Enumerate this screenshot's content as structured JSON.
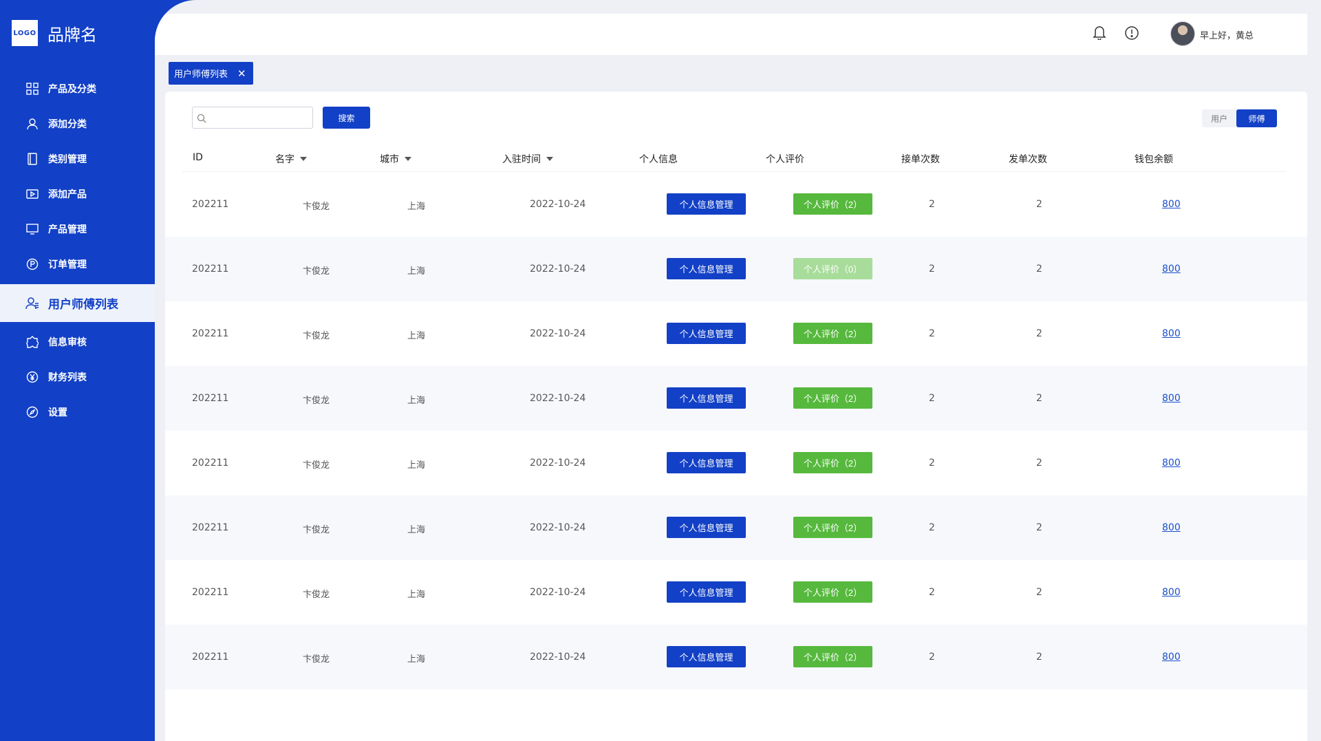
{
  "brand": {
    "logo_text": "LOGO",
    "name": "品牌名"
  },
  "sidebar": {
    "items": [
      {
        "label": "产品及分类",
        "icon": "grid-icon"
      },
      {
        "label": "添加分类",
        "icon": "user-icon"
      },
      {
        "label": "类别管理",
        "icon": "book-icon"
      },
      {
        "label": "添加产品",
        "icon": "video-icon"
      },
      {
        "label": "产品管理",
        "icon": "monitor-icon"
      },
      {
        "label": "订单管理",
        "icon": "order-icon"
      },
      {
        "label": "用户师傅列表",
        "icon": "users-icon",
        "active": true
      },
      {
        "label": "信息审核",
        "icon": "audit-icon"
      },
      {
        "label": "财务列表",
        "icon": "yen-icon"
      },
      {
        "label": "设置",
        "icon": "compass-icon"
      }
    ]
  },
  "header": {
    "greeting": "早上好，黄总"
  },
  "tabs": [
    {
      "label": "用户师傅列表"
    }
  ],
  "toolbar": {
    "search_placeholder": "",
    "search_label": "搜索",
    "toggle": [
      "用户",
      "师傅"
    ],
    "toggle_selected": "师傅"
  },
  "table": {
    "headers": [
      "ID",
      "名字",
      "城市",
      "入驻时间",
      "个人信息",
      "个人评价",
      "接单次数",
      "发单次数",
      "钱包余额"
    ],
    "info_btn_label": "个人信息管理",
    "rows": [
      {
        "id": "202211",
        "name": "卞俊龙",
        "city": "上海",
        "date": "2022-10-24",
        "review": "个人评价（2）",
        "review_disabled": false,
        "accept": "2",
        "send": "2",
        "wallet": "800"
      },
      {
        "id": "202211",
        "name": "卞俊龙",
        "city": "上海",
        "date": "2022-10-24",
        "review": "个人评价（0）",
        "review_disabled": true,
        "accept": "2",
        "send": "2",
        "wallet": "800"
      },
      {
        "id": "202211",
        "name": "卞俊龙",
        "city": "上海",
        "date": "2022-10-24",
        "review": "个人评价（2）",
        "review_disabled": false,
        "accept": "2",
        "send": "2",
        "wallet": "800"
      },
      {
        "id": "202211",
        "name": "卞俊龙",
        "city": "上海",
        "date": "2022-10-24",
        "review": "个人评价（2）",
        "review_disabled": false,
        "accept": "2",
        "send": "2",
        "wallet": "800"
      },
      {
        "id": "202211",
        "name": "卞俊龙",
        "city": "上海",
        "date": "2022-10-24",
        "review": "个人评价（2）",
        "review_disabled": false,
        "accept": "2",
        "send": "2",
        "wallet": "800"
      },
      {
        "id": "202211",
        "name": "卞俊龙",
        "city": "上海",
        "date": "2022-10-24",
        "review": "个人评价（2）",
        "review_disabled": false,
        "accept": "2",
        "send": "2",
        "wallet": "800"
      },
      {
        "id": "202211",
        "name": "卞俊龙",
        "city": "上海",
        "date": "2022-10-24",
        "review": "个人评价（2）",
        "review_disabled": false,
        "accept": "2",
        "send": "2",
        "wallet": "800"
      },
      {
        "id": "202211",
        "name": "卞俊龙",
        "city": "上海",
        "date": "2022-10-24",
        "review": "个人评价（2）",
        "review_disabled": false,
        "accept": "2",
        "send": "2",
        "wallet": "800"
      }
    ]
  },
  "colors": {
    "primary": "#1240c6",
    "success": "#56b93d",
    "success_disabled": "#a8dc9a"
  }
}
